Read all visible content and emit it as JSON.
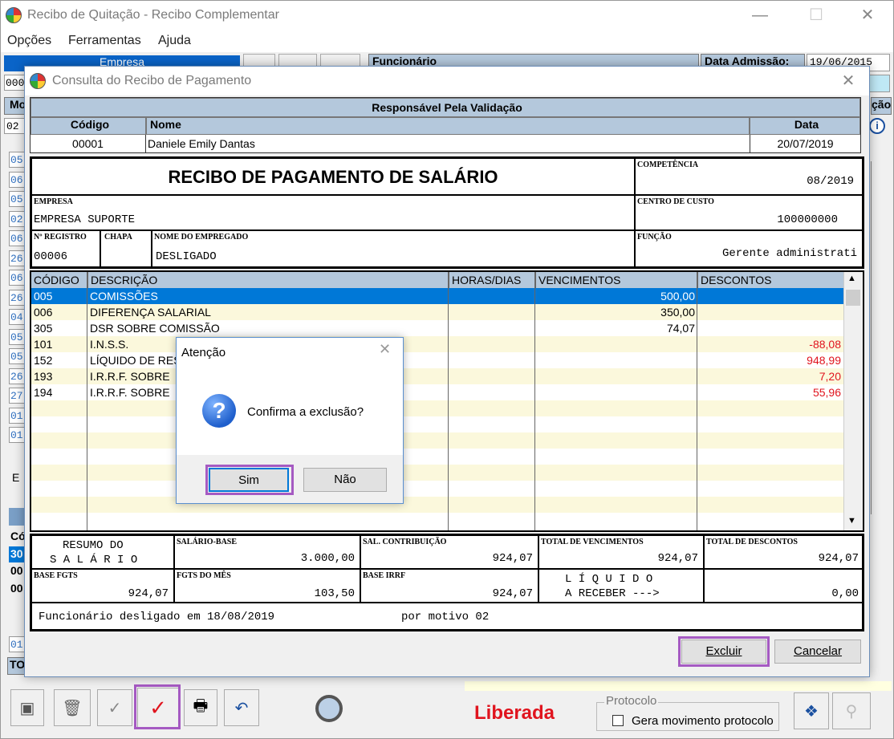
{
  "main": {
    "title": "Recibo de Quitação - Recibo Complementar",
    "menu": [
      "Opções",
      "Ferramentas",
      "Ajuda"
    ],
    "empresa_label": "Empresa",
    "funcionario_label": "Funcionário",
    "admissao_label": "Data Admissão:",
    "admissao_value": "19/06/2015",
    "left_codes": [
      "05",
      "06",
      "05",
      "02",
      "06",
      "26",
      "06",
      "26",
      "04",
      "05",
      "05",
      "26",
      "27",
      "01",
      "01"
    ],
    "left_partial_top": "000",
    "left_partial_mo": "Mo",
    "left_partial_02": "02",
    "left_partial_e": "E",
    "left_partial_co": "Có",
    "left_partial_30": "30",
    "left_partial_00a": "00",
    "left_partial_00b": "00",
    "left_partial_01": "01",
    "left_partial_to": "TO",
    "right_partial_cao": "ção",
    "status_text": "Liberada",
    "protocolo_label": "Protocolo",
    "gera_movimento_label": "Gera movimento protocolo",
    "colors": {
      "status": "#e0141e",
      "highlight": "#a55ac2",
      "header_blue": "#b4c8dc",
      "selection": "#0078d7"
    }
  },
  "consulta": {
    "title": "Consulta do Recibo de Pagamento",
    "responsavel_header": "Responsável Pela Validação",
    "codigo_header": "Código",
    "nome_header": "Nome",
    "data_header": "Data",
    "codigo_value": "00001",
    "nome_value": "Daniele Emily Dantas",
    "data_value": "20/07/2019",
    "recibo_title": "RECIBO DE PAGAMENTO DE SALÁRIO",
    "competencia_label": "COMPETÊNCIA",
    "competencia_value": "08/2019",
    "empresa_label": "EMPRESA",
    "empresa_value": "EMPRESA SUPORTE",
    "centro_custo_label": "CENTRO DE CUSTO",
    "centro_custo_value": "100000000",
    "registro_label": "Nº REGISTRO",
    "registro_value": "00006",
    "chapa_label": "CHAPA",
    "nome_empregado_label": "NOME DO EMPREGADO",
    "nome_empregado_value": "DESLIGADO",
    "funcao_label": "FUNÇÃO",
    "funcao_value": "Gerente administrati",
    "grid_headers": [
      "CÓDIGO",
      "DESCRIÇÃO",
      "HORAS/DIAS",
      "VENCIMENTOS",
      "DESCONTOS"
    ],
    "rows": [
      {
        "codigo": "005",
        "descricao": "COMISSÕES",
        "horas": "",
        "venc": "500,00",
        "desc": ""
      },
      {
        "codigo": "006",
        "descricao": "DIFERENÇA SALARIAL",
        "horas": "",
        "venc": "350,00",
        "desc": ""
      },
      {
        "codigo": "305",
        "descricao": "DSR SOBRE COMISSÃO",
        "horas": "",
        "venc": "74,07",
        "desc": ""
      },
      {
        "codigo": "101",
        "descricao": "I.N.S.S.",
        "horas": "",
        "venc": "",
        "desc": "-88,08"
      },
      {
        "codigo": "152",
        "descricao": "LÍQUIDO DE RES",
        "horas": "",
        "venc": "",
        "desc": "948,99"
      },
      {
        "codigo": "193",
        "descricao": "I.R.R.F. SOBRE",
        "horas": "",
        "venc": "",
        "desc": "7,20"
      },
      {
        "codigo": "194",
        "descricao": "I.R.R.F. SOBRE",
        "horas": "",
        "venc": "",
        "desc": "55,96"
      }
    ],
    "resumo_label_1": "RESUMO DO",
    "resumo_label_2": "S A L Á R I O",
    "salario_base_label": "SALÁRIO-BASE",
    "salario_base_value": "3.000,00",
    "sal_contribuicao_label": "SAL. CONTRIBUIÇÃO",
    "sal_contribuicao_value": "924,07",
    "total_vencimentos_label": "TOTAL DE VENCIMENTOS",
    "total_vencimentos_value": "924,07",
    "total_descontos_label": "TOTAL DE DESCONTOS",
    "total_descontos_value": "924,07",
    "base_fgts_label": "BASE FGTS",
    "base_fgts_value": "924,07",
    "fgts_mes_label": "FGTS DO MÊS",
    "fgts_mes_value": "103,50",
    "base_irrf_label": "BASE IRRF",
    "base_irrf_value": "924,07",
    "liquido_label_1": "L Í Q U I D O",
    "liquido_label_2": "A RECEBER --->",
    "liquido_value": "0,00",
    "footer_text_1": "Funcionário desligado em 18/08/2019",
    "footer_text_2": "por motivo 02",
    "excluir_label": "Excluir",
    "cancelar_label": "Cancelar"
  },
  "atencao": {
    "title": "Atenção",
    "message": "Confirma a exclusão?",
    "sim_label": "Sim",
    "nao_label": "Não"
  }
}
